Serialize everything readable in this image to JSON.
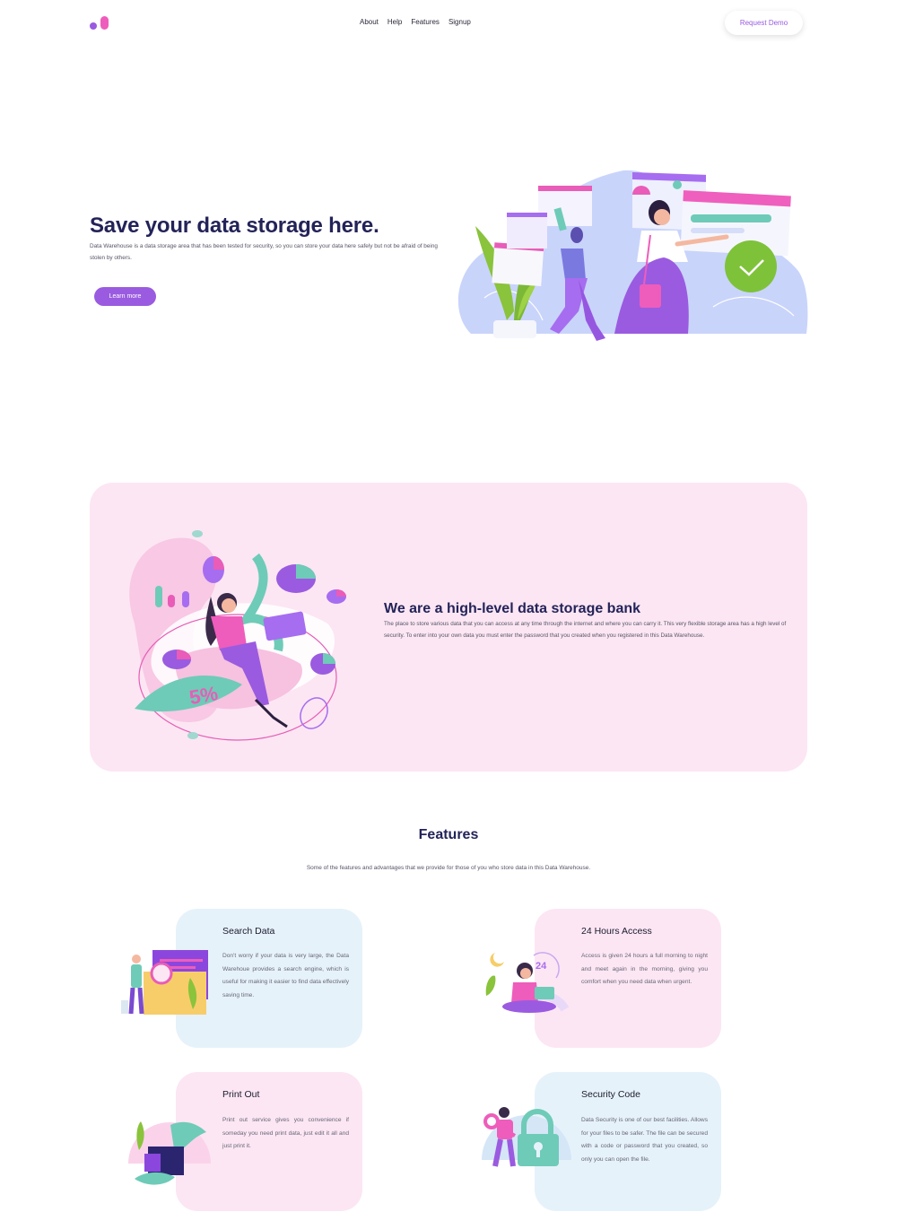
{
  "header": {
    "nav": [
      "About",
      "Help",
      "Features",
      "Signup"
    ],
    "demo_label": "Request Demo"
  },
  "hero": {
    "title": "Save your data storage here.",
    "text": "Data Warehouse is a data storage area that has been tested for security, so you can store your data here safely but not be afraid of being stolen by others.",
    "button": "Learn more"
  },
  "bank": {
    "title": "We are a high-level data storage bank",
    "text": "The place to store various data that you can access at any time through the internet and where you can carry it. This very flexible storage area has a high level of security. To enter into your own data you must enter the password that you created when you registered in this Data Warehouse.",
    "badge": "5%"
  },
  "features": {
    "title": "Features",
    "subtitle": "Some of the features and advantages that we provide for those of you who store data in this Data Warehouse.",
    "items": [
      {
        "title": "Search Data",
        "text": "Don't worry if your data is very large, the Data Warehoue provides a search engine, which is useful for making it easier to find data effectively saving time."
      },
      {
        "title": "24 Hours Access",
        "text": "Access is given 24 hours a full morning to night and meet again in the morning, giving you comfort when you need data when urgent.",
        "badge": "24"
      },
      {
        "title": "Print Out",
        "text": "Print out service gives you convenience if someday you need print data, just edit it all and just print it."
      },
      {
        "title": "Security Code",
        "text": "Data Security is one of our best facilities. Allows for your files to be safer. The file can be secured with a code or password that you created, so only you can open the file."
      }
    ]
  },
  "colors": {
    "primary": "#9a5be0",
    "accent_pink": "#ee5dbb",
    "heading": "#232359",
    "card_pink": "#fce6f3",
    "card_blue": "#e6f2fa"
  }
}
